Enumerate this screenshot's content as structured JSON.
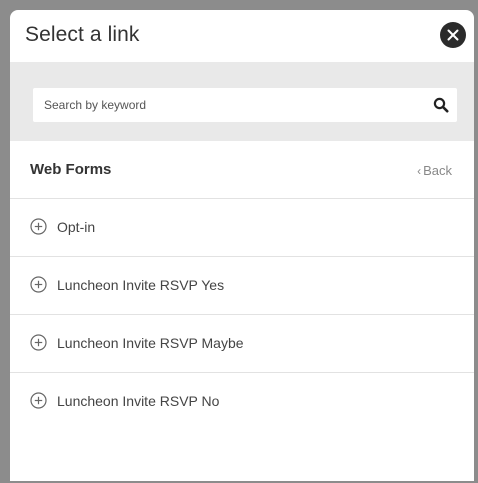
{
  "dialog": {
    "title": "Select a link",
    "close_icon": "close-icon"
  },
  "search": {
    "placeholder": "Search by keyword",
    "value": "",
    "icon": "search-icon"
  },
  "section": {
    "title": "Web Forms",
    "back_chevron": "‹",
    "back_label": "Back"
  },
  "items": [
    {
      "label": "Opt-in",
      "icon": "plus-circle-icon"
    },
    {
      "label": "Luncheon Invite RSVP Yes",
      "icon": "plus-circle-icon"
    },
    {
      "label": "Luncheon Invite RSVP Maybe",
      "icon": "plus-circle-icon"
    },
    {
      "label": "Luncheon Invite RSVP No",
      "icon": "plus-circle-icon"
    }
  ],
  "colors": {
    "backdrop": "#8c8c8c",
    "search_band": "#e9e9e9",
    "close_button": "#2b2b2b",
    "text": "#333333",
    "muted": "#888888"
  }
}
